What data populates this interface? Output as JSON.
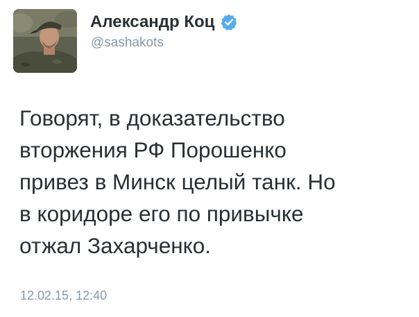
{
  "author": {
    "display_name": "Александр Коц",
    "handle": "@sashakots",
    "verified_icon": "verified-badge-icon",
    "verified_color": "#55acee"
  },
  "tweet": {
    "lines": [
      "Говорят, в доказательство",
      "вторжения РФ Порошенко",
      "привез в Минск целый танк. Но",
      "в коридоре его по привычке",
      "отжал Захарченко."
    ],
    "timestamp": "12.02.15, 12:40"
  },
  "colors": {
    "text": "#292f33",
    "secondary": "#8899a6",
    "background": "#ffffff"
  }
}
